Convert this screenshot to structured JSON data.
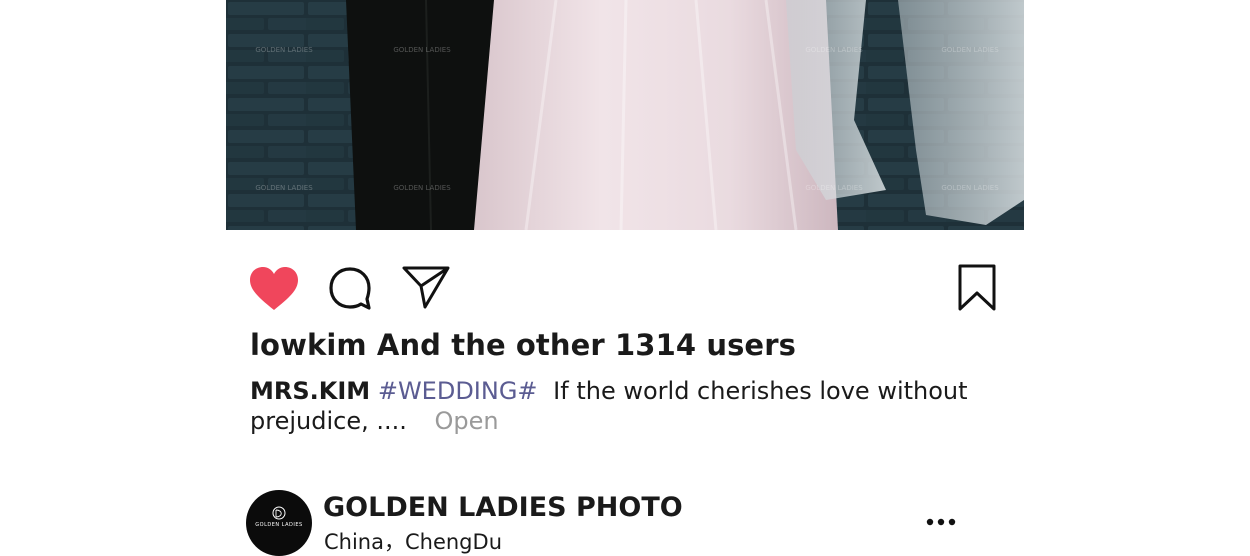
{
  "post": {
    "likes_text": "lowkim And the other 1314 users",
    "caption": {
      "username": "MRS.KIM",
      "hashtag": "#WEDDING#",
      "text": "If the world cherishes love without prejudice, ....",
      "open_label": "Open"
    },
    "watermark": "GOLDEN LADIES",
    "liked": true
  },
  "actions": {
    "like_icon": "heart-icon",
    "comment_icon": "comment-icon",
    "share_icon": "send-icon",
    "save_icon": "bookmark-icon"
  },
  "author": {
    "name": "GOLDEN LADIES PHOTO",
    "location": "China，ChengDu",
    "avatar_text": "GOLDEN LADIES",
    "more_icon": "more-horizontal-icon"
  },
  "colors": {
    "heart": "#f0465c",
    "hashtag": "#5b5c92",
    "open": "#9a9a9a"
  }
}
